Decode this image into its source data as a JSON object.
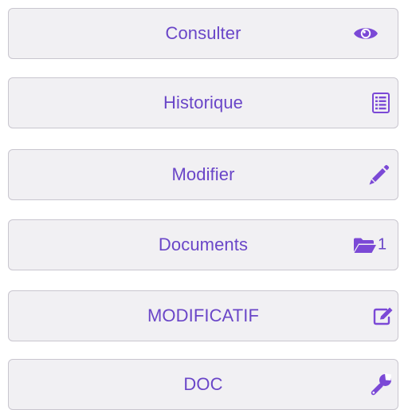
{
  "actions": [
    {
      "label": "Consulter",
      "icon": "eye-icon"
    },
    {
      "label": "Historique",
      "icon": "list-icon"
    },
    {
      "label": "Modifier",
      "icon": "pencil-icon"
    },
    {
      "label": "Documents",
      "icon": "folder-open-icon",
      "badge": "1"
    },
    {
      "label": "MODIFICATIF",
      "icon": "edit-square-icon"
    },
    {
      "label": "DOC",
      "icon": "wrench-icon"
    }
  ],
  "colors": {
    "accent": "#7b49d6",
    "text": "#6a46c8",
    "button_bg": "#f1f0f3",
    "border": "#c9c6cf"
  }
}
